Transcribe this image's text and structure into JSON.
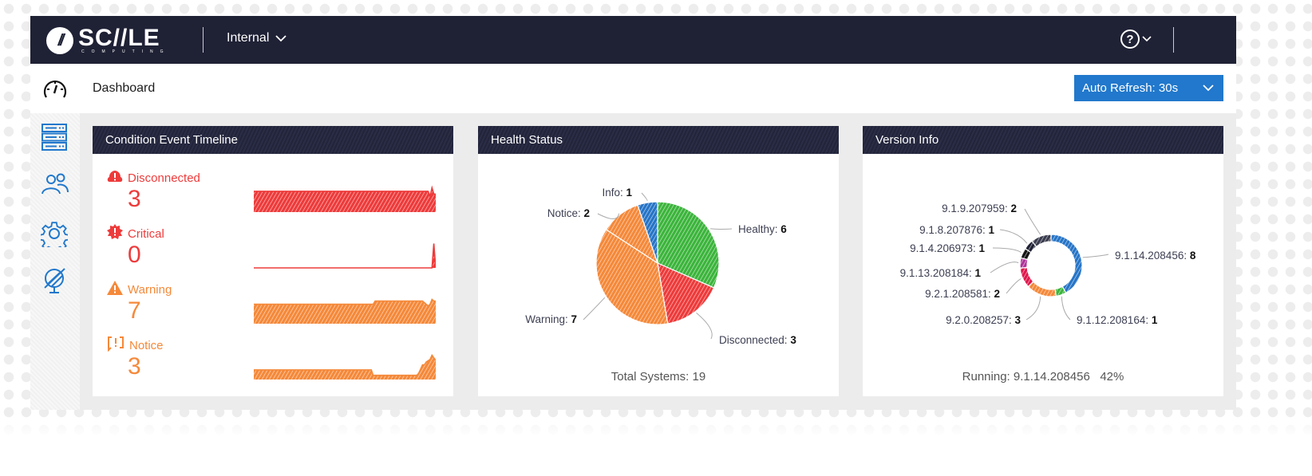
{
  "topbar": {
    "logo_word": "SC//LE",
    "logo_sub": "COMPUTING",
    "environment": "Internal",
    "help_icon": "question-circle-icon"
  },
  "subheader": {
    "page_title": "Dashboard",
    "auto_refresh_label": "Auto Refresh: 30s"
  },
  "sidebar": {
    "items": [
      {
        "name": "dashboard",
        "icon": "speedometer-icon"
      },
      {
        "name": "clusters",
        "icon": "server-rack-icon"
      },
      {
        "name": "users",
        "icon": "users-icon"
      },
      {
        "name": "settings",
        "icon": "gear-icon"
      },
      {
        "name": "disabled-global",
        "icon": "globe-slash-icon"
      }
    ]
  },
  "colors": {
    "topbar": "#1f2135",
    "accent": "#2178cc",
    "disconnected": "#ee3b3b",
    "critical": "#ee3b3b",
    "warning": "#f5893a",
    "notice": "#f5893a",
    "healthy": "#3cb53c",
    "info": "#2775c7"
  },
  "condition_timeline": {
    "title": "Condition Event Timeline",
    "items": [
      {
        "label": "Disconnected",
        "count": "3",
        "icon": "alert-cloud-icon",
        "color": "#ee3b3b",
        "trend": [
          3,
          3,
          3,
          3,
          3,
          3,
          3,
          3,
          3,
          3,
          3,
          3,
          3,
          3,
          3,
          3,
          3,
          3,
          3,
          3,
          3,
          3,
          3,
          3,
          3,
          3,
          3,
          3,
          3,
          3,
          3,
          3,
          3,
          3,
          3,
          3,
          3,
          3,
          3,
          3,
          3,
          3,
          3,
          3,
          3,
          3,
          3,
          3,
          3,
          3,
          3,
          3,
          3,
          3,
          3,
          3,
          3,
          3,
          3,
          3,
          3,
          3,
          3,
          3,
          3,
          3,
          3,
          3,
          3,
          3,
          3,
          3,
          3,
          3,
          3,
          3,
          3,
          3,
          3,
          3,
          3,
          3,
          3,
          3,
          3,
          3,
          3,
          3,
          3,
          3,
          3,
          3,
          3,
          2.3,
          3.5,
          2.6,
          2.6
        ]
      },
      {
        "label": "Critical",
        "count": "0",
        "icon": "alert-burst-icon",
        "color": "#ee3b3b",
        "trend": [
          0,
          0,
          0,
          0,
          0,
          0,
          0,
          0,
          0,
          0,
          0,
          0,
          0,
          0,
          0,
          0,
          0,
          0,
          0,
          0,
          0,
          0,
          0,
          0,
          0,
          0,
          0,
          0,
          0,
          0,
          0,
          0,
          0,
          0,
          0,
          0,
          0,
          0,
          0,
          0,
          0,
          0,
          0,
          0,
          0,
          0,
          0,
          0,
          0,
          0,
          0,
          0,
          0,
          0,
          0,
          0,
          0,
          0,
          0,
          0,
          0,
          0,
          0,
          0,
          0,
          0,
          0,
          0,
          0,
          0,
          0,
          0,
          0,
          0,
          0,
          0,
          0,
          0,
          0,
          0,
          0,
          0,
          0,
          0,
          0,
          0,
          0,
          0,
          0,
          0,
          0,
          0,
          0,
          0,
          0,
          3,
          0
        ]
      },
      {
        "label": "Warning",
        "count": "7",
        "icon": "warning-triangle-icon",
        "color": "#f5893a",
        "trend": [
          6,
          6,
          6,
          6,
          6,
          6,
          6,
          6,
          6,
          6,
          6,
          6,
          6,
          6,
          6,
          6,
          6,
          6,
          6,
          6,
          6,
          6,
          6,
          6,
          6,
          6,
          6,
          6,
          6,
          6,
          6,
          6,
          6,
          6,
          6,
          6,
          6,
          6,
          6,
          6,
          6,
          6,
          6,
          6,
          6,
          6,
          6,
          6,
          6,
          6,
          6,
          6,
          6,
          6,
          6,
          6,
          6,
          6,
          6,
          6,
          6,
          6,
          6,
          6,
          7,
          7,
          7,
          7,
          7,
          7,
          7,
          7,
          7,
          7,
          7,
          7,
          7,
          7,
          7,
          7,
          7,
          7,
          7,
          7,
          7,
          7,
          7,
          7,
          7,
          7,
          6.5,
          6,
          5.5,
          6,
          7.5,
          7,
          7
        ]
      },
      {
        "label": "Notice",
        "count": "3",
        "icon": "notice-bracket-icon",
        "color": "#f5893a",
        "trend": [
          2.3,
          2.3,
          2.3,
          2.3,
          2.3,
          2.3,
          2.3,
          2.3,
          2.3,
          2.3,
          2.3,
          2.3,
          2.3,
          2.3,
          2.3,
          2.3,
          2.3,
          2.3,
          2.3,
          2.3,
          2.3,
          2.3,
          2.3,
          2.3,
          2.3,
          2.3,
          2.3,
          2.3,
          2.3,
          2.3,
          2.3,
          2.3,
          2.3,
          2.3,
          2.3,
          2.3,
          2.3,
          2.3,
          2.3,
          2.3,
          2.3,
          2.3,
          2.3,
          2.3,
          2.3,
          2.3,
          2.3,
          2.3,
          2.3,
          2.3,
          2.3,
          2.3,
          2.3,
          2.3,
          2.3,
          2.3,
          2.3,
          2.3,
          2.3,
          2.3,
          2.3,
          2.3,
          2.3,
          1,
          1,
          1,
          1,
          1,
          1,
          1,
          1,
          1,
          1,
          1,
          1,
          1,
          1,
          1,
          1,
          1,
          1,
          1,
          1,
          1,
          1,
          1,
          1,
          1.5,
          2.5,
          3.5,
          3.5,
          4.2,
          4.5,
          4.8,
          5.8,
          5.2,
          4.6
        ]
      }
    ]
  },
  "health_status": {
    "title": "Health Status",
    "total_label": "Total Systems: 19"
  },
  "version_info": {
    "title": "Version Info",
    "running_label": "Running: 9.1.14.208456",
    "running_percent": "42%"
  },
  "chart_data": [
    {
      "type": "pie",
      "title": "Health Status",
      "slices": [
        {
          "label": "Healthy",
          "value": 6,
          "color": "#3cb53c"
        },
        {
          "label": "Disconnected",
          "value": 3,
          "color": "#ee3b3b"
        },
        {
          "label": "Warning",
          "value": 7,
          "color": "#f5893a"
        },
        {
          "label": "Notice",
          "value": 2,
          "color": "#f5893a"
        },
        {
          "label": "Info",
          "value": 1,
          "color": "#2775c7"
        }
      ],
      "total": 19
    },
    {
      "type": "pie",
      "subtype": "donut",
      "title": "Version Info",
      "slices": [
        {
          "label": "9.1.14.208456",
          "value": 8,
          "color": "#2775c7"
        },
        {
          "label": "9.1.12.208164",
          "value": 1,
          "color": "#3cb53c"
        },
        {
          "label": "9.2.0.208257",
          "value": 3,
          "color": "#f5893a"
        },
        {
          "label": "9.2.1.208581",
          "value": 2,
          "color": "#e0184c"
        },
        {
          "label": "9.1.13.208184",
          "value": 1,
          "color": "#b0339b"
        },
        {
          "label": "9.1.4.206973",
          "value": 1,
          "color": "#151515"
        },
        {
          "label": "9.1.8.207876",
          "value": 1,
          "color": "#1f2135"
        },
        {
          "label": "9.1.9.207959",
          "value": 2,
          "color": "#3b3d4f"
        }
      ],
      "total": 19
    }
  ]
}
